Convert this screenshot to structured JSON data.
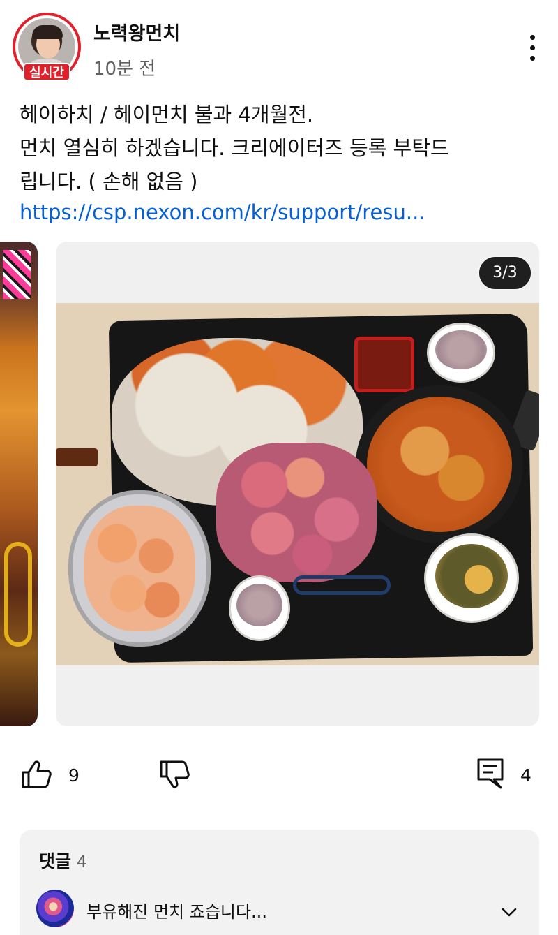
{
  "header": {
    "channel_name": "노력왕먼치",
    "post_time": "10분 전",
    "live_badge": "실시간"
  },
  "post": {
    "lines": [
      "헤이하치  / 헤이먼치  불과 4개월전.",
      "먼치 열심히 하겠습니다. 크리에이터즈 등록 부탁드",
      "립니다.  ( 손해 없음 )"
    ],
    "link_text": "https://csp.nexon.com/kr/support/resu..."
  },
  "carousel": {
    "counter": "3/3"
  },
  "actions": {
    "like_count": "9",
    "comment_count": "4",
    "icons": [
      "thumbs-up-icon",
      "thumbs-down-icon",
      "comment-icon"
    ]
  },
  "comments": {
    "title": "댓글",
    "count": "4",
    "preview_text": "부유해진 먼치 죠습니다...",
    "expand_icon": "chevron-down-icon"
  },
  "colors": {
    "live_red": "#e0202a",
    "link_blue": "#065fd4",
    "secondary_text": "#606060"
  }
}
